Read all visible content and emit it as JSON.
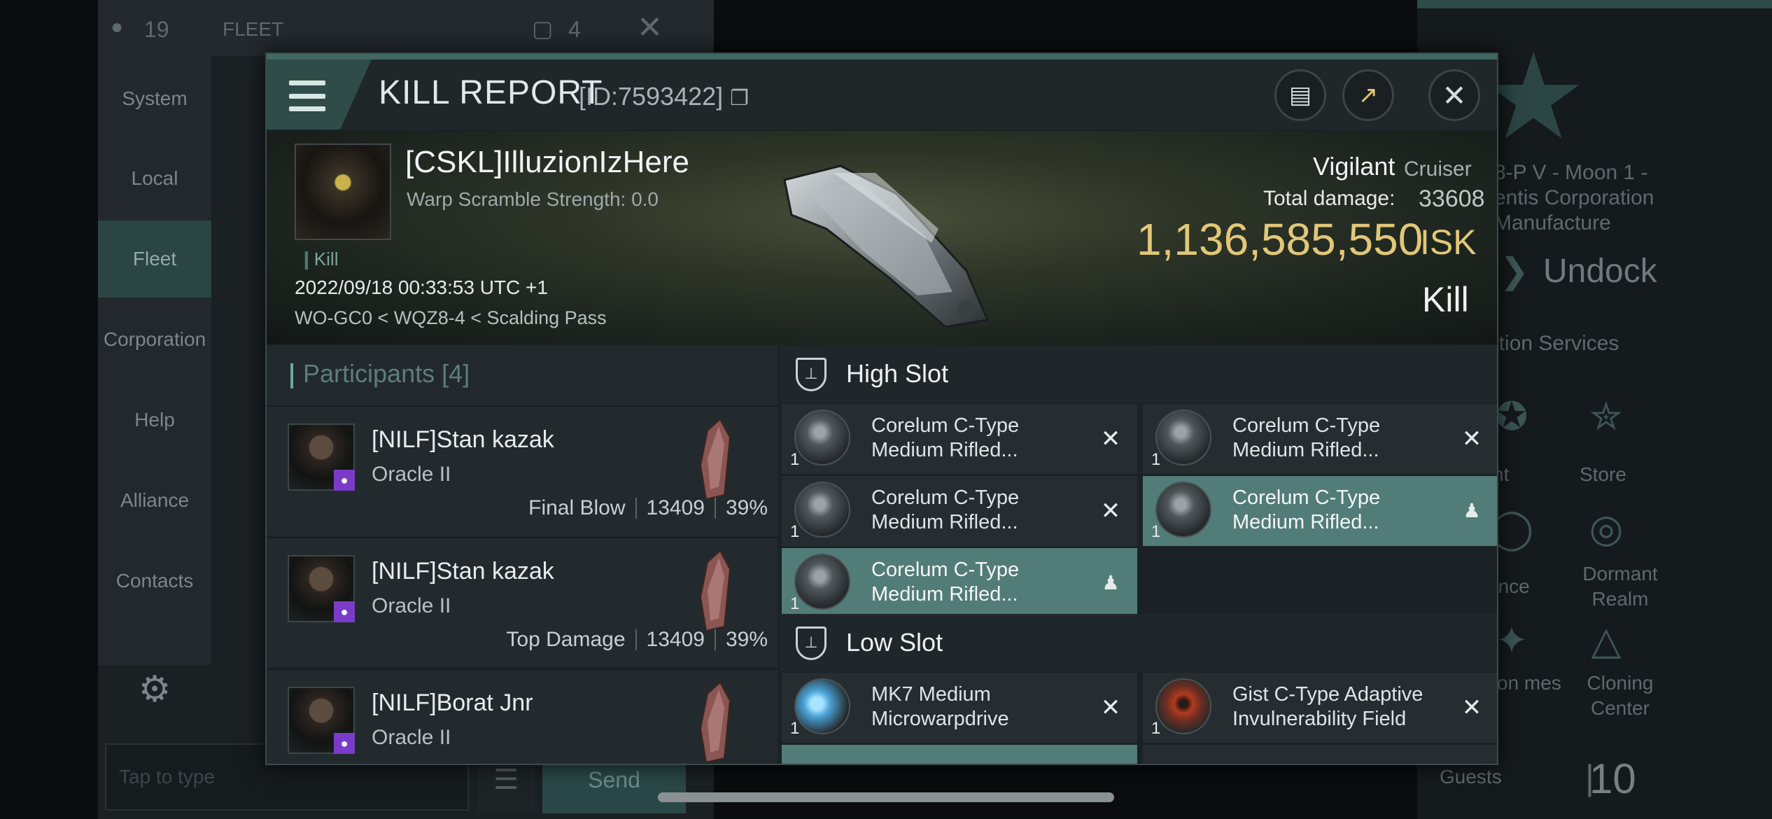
{
  "background": {
    "fleet_count": "19",
    "tab_label": "FLEET",
    "window_count": "4",
    "sidebar": [
      "System",
      "Local",
      "Fleet",
      "Corporation",
      "Help",
      "Alliance",
      "Contacts"
    ],
    "chat_placeholder": "Tap to type",
    "send_label": "Send",
    "station_name_lines": [
      "8-P V - Moon 1 -",
      "entis Corporation",
      "Manufacture"
    ],
    "undock_label": "Undock",
    "services_label": "ation Services",
    "services": [
      {
        "label": "nt",
        "icon": "star-icon"
      },
      {
        "label": "Store",
        "icon": "nes-store-icon"
      },
      {
        "label": "ance",
        "icon": "insurance-icon"
      },
      {
        "label": "Dormant Realm",
        "icon": "dormant-realm-icon"
      },
      {
        "label": "tion mes",
        "icon": "reprocessing-icon"
      },
      {
        "label": "Cloning Center",
        "icon": "cloning-icon"
      }
    ],
    "guests_label": "Guests",
    "guests_count": "10"
  },
  "header": {
    "title": "KILL REPORT",
    "id_text": "[ID:7593422]",
    "copy_icon": "copy-icon"
  },
  "victim": {
    "name": "[CSKL]IlluzionIzHere",
    "warp_scramble": "Warp Scramble Strength: 0.0",
    "tag": "Kill",
    "timestamp": "2022/09/18 00:33:53 UTC +1",
    "location": "WO-GC0 < WQZ8-4 < Scalding Pass",
    "ship_name": "Vigilant",
    "ship_class": "Cruiser",
    "damage_label": "Total damage:",
    "damage_value": "33608",
    "isk_value": "1,136,585,550",
    "isk_unit": "ISK",
    "result": "Kill"
  },
  "participants": {
    "title": "Participants [4]",
    "rows": [
      {
        "name": "[NILF]Stan kazak",
        "ship": "Oracle II",
        "label": "Final Blow",
        "damage": "13409",
        "percent": "39%"
      },
      {
        "name": "[NILF]Stan kazak",
        "ship": "Oracle II",
        "label": "Top Damage",
        "damage": "13409",
        "percent": "39%"
      },
      {
        "name": "[NILF]Borat Jnr",
        "ship": "Oracle II",
        "label": "",
        "damage": "",
        "percent": ""
      }
    ]
  },
  "high_slot": {
    "title": "High Slot",
    "modules": [
      {
        "name": "Corelum C-Type Medium Rifled...",
        "qty": "1",
        "status": "destroyed"
      },
      {
        "name": "Corelum C-Type Medium Rifled...",
        "qty": "1",
        "status": "destroyed"
      },
      {
        "name": "Corelum C-Type Medium Rifled...",
        "qty": "1",
        "status": "destroyed"
      },
      {
        "name": "Corelum C-Type Medium Rifled...",
        "qty": "1",
        "status": "dropped"
      },
      {
        "name": "Corelum C-Type Medium Rifled...",
        "qty": "1",
        "status": "dropped"
      }
    ]
  },
  "low_slot": {
    "title": "Low Slot",
    "modules": [
      {
        "name": "MK7 Medium Microwarpdrive",
        "qty": "1",
        "status": "destroyed"
      },
      {
        "name": "Gist C-Type Adaptive Invulnerability Field",
        "qty": "1",
        "status": "destroyed"
      }
    ]
  },
  "colors": {
    "accent": "#527c77",
    "isk": "#e2c778",
    "corp_badge": "#7a3cc8"
  }
}
